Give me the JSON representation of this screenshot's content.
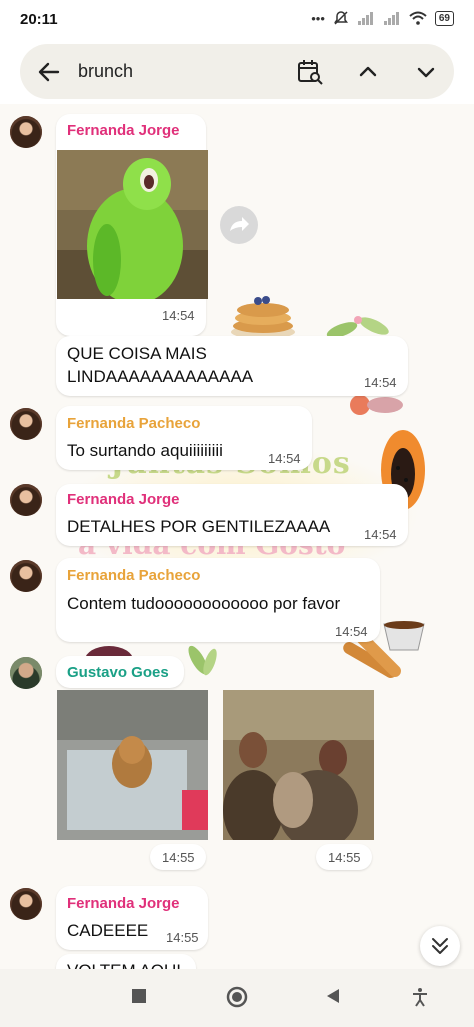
{
  "status_bar": {
    "time": "20:11",
    "battery": "69"
  },
  "search": {
    "query": "brunch"
  },
  "background_banner": {
    "line1": "Juntas Somos",
    "line2": "a vida com Gosto"
  },
  "messages": [
    {
      "sender": "Fernanda Jorge",
      "time": "14:54"
    },
    {
      "text": "QUE COISA MAIS\nLINDAAAAAAAAAAAAA",
      "time": "14:54"
    },
    {
      "sender": "Fernanda Pacheco",
      "text": "To surtando aquiiiiiiiii",
      "time": "14:54"
    },
    {
      "sender": "Fernanda Jorge",
      "text": "DETALHES POR GENTILEZAAAA",
      "time": "14:54"
    },
    {
      "sender": "Fernanda Pacheco",
      "text": "Contem tudoooooooooooo por favor",
      "time": "14:54"
    },
    {
      "sender": "Gustavo Goes",
      "time1": "14:55",
      "time2": "14:55"
    },
    {
      "sender": "Fernanda Jorge",
      "text": "CADEEEE",
      "time": "14:55"
    },
    {
      "text": "VOLTEM AQUI"
    }
  ],
  "colors": {
    "fernanda_jorge": "#e0307a",
    "fernanda_pacheco": "#e8a33a",
    "gustavo_goes": "#1aa086",
    "nav_bg": "#f5f3ef",
    "search_bg": "#f1efe9"
  }
}
